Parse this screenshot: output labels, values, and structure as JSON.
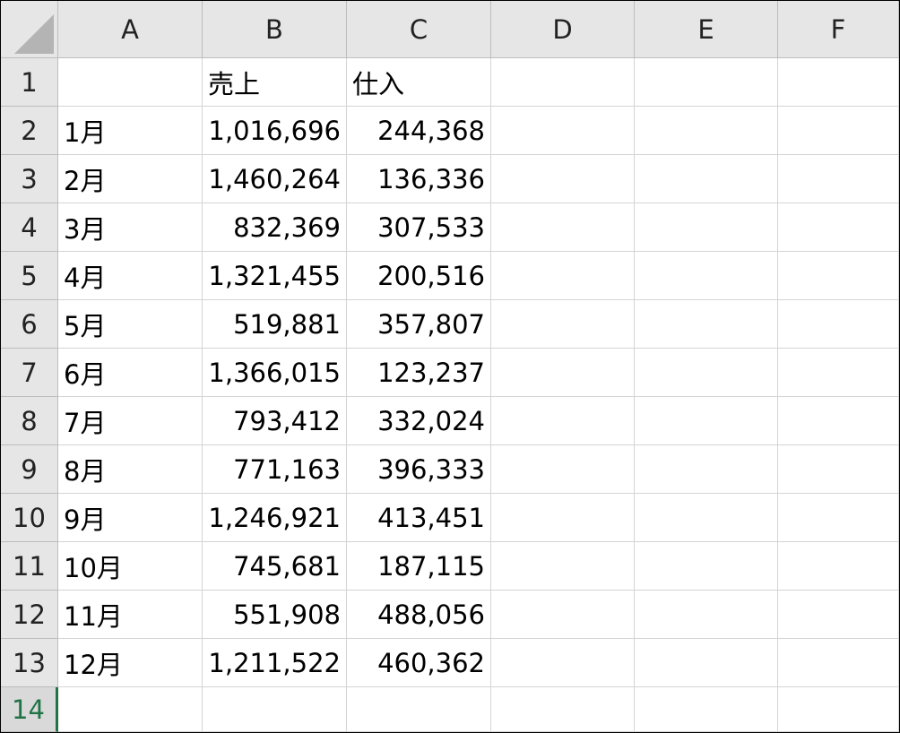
{
  "columns": [
    "A",
    "B",
    "C",
    "D",
    "E",
    "F"
  ],
  "header_row": {
    "row": "1",
    "a": "",
    "b": "売上",
    "c": "仕入"
  },
  "rows": [
    {
      "row": "2",
      "month": "1月",
      "sales": "1,016,696",
      "purchases": "244,368"
    },
    {
      "row": "3",
      "month": "2月",
      "sales": "1,460,264",
      "purchases": "136,336"
    },
    {
      "row": "4",
      "month": "3月",
      "sales": "832,369",
      "purchases": "307,533"
    },
    {
      "row": "5",
      "month": "4月",
      "sales": "1,321,455",
      "purchases": "200,516"
    },
    {
      "row": "6",
      "month": "5月",
      "sales": "519,881",
      "purchases": "357,807"
    },
    {
      "row": "7",
      "month": "6月",
      "sales": "1,366,015",
      "purchases": "123,237"
    },
    {
      "row": "8",
      "month": "7月",
      "sales": "793,412",
      "purchases": "332,024"
    },
    {
      "row": "9",
      "month": "8月",
      "sales": "771,163",
      "purchases": "396,333"
    },
    {
      "row": "10",
      "month": "9月",
      "sales": "1,246,921",
      "purchases": "413,451"
    },
    {
      "row": "11",
      "month": "10月",
      "sales": "745,681",
      "purchases": "187,115"
    },
    {
      "row": "12",
      "month": "11月",
      "sales": "551,908",
      "purchases": "488,056"
    },
    {
      "row": "13",
      "month": "12月",
      "sales": "1,211,522",
      "purchases": "460,362"
    }
  ],
  "active_row": "14",
  "colors": {
    "header_bg": "#e6e6e6",
    "active_accent": "#217346",
    "grid_line": "#d4d4d4"
  }
}
